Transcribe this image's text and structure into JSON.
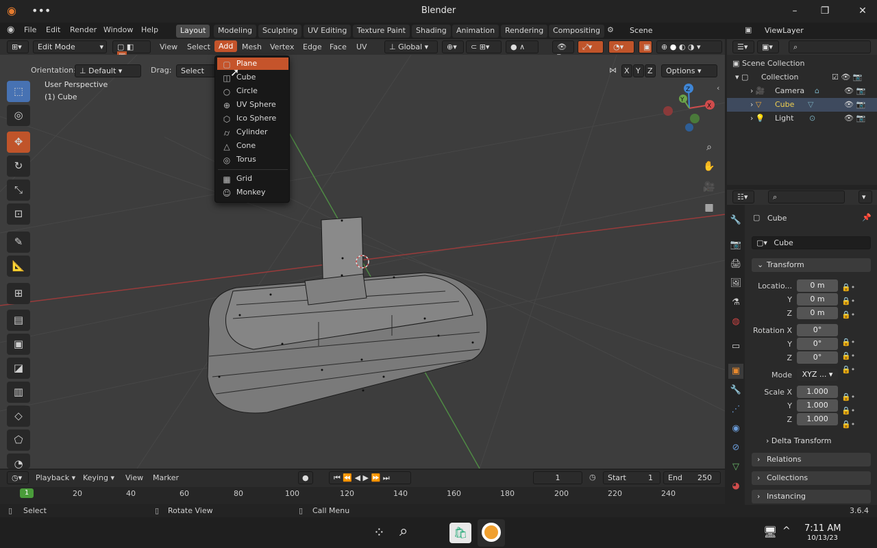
{
  "title_bar": {
    "title": "Blender",
    "min": "–",
    "max": "❐",
    "close": "✕"
  },
  "menus": [
    "File",
    "Edit",
    "Render",
    "Window",
    "Help"
  ],
  "workspaces": [
    "Layout",
    "Modeling",
    "Sculpting",
    "UV Editing",
    "Texture Paint",
    "Shading",
    "Animation",
    "Rendering",
    "Compositing"
  ],
  "scene": "Scene",
  "view_layer": "ViewLayer",
  "header": {
    "mode": "Edit Mode",
    "menus": [
      "View",
      "Select",
      "Add",
      "Mesh",
      "Vertex",
      "Edge",
      "Face",
      "UV"
    ],
    "transform_orientation": "Global",
    "orientation_label": "Orientation:",
    "orientation_value": "Default",
    "drag_label": "Drag:",
    "drag_value": "Select Bo",
    "axes": [
      "X",
      "Y",
      "Z"
    ],
    "options": "Options"
  },
  "viewport": {
    "line1": "User Perspective",
    "line2": "(1) Cube"
  },
  "add_menu": {
    "items": [
      {
        "label": "Plane",
        "icon": "plane-icon"
      },
      {
        "label": "Cube",
        "icon": "cube-icon"
      },
      {
        "label": "Circle",
        "icon": "circle-icon"
      },
      {
        "label": "UV Sphere",
        "icon": "uv-sphere-icon"
      },
      {
        "label": "Ico Sphere",
        "icon": "ico-sphere-icon"
      },
      {
        "label": "Cylinder",
        "icon": "cylinder-icon"
      },
      {
        "label": "Cone",
        "icon": "cone-icon"
      },
      {
        "label": "Torus",
        "icon": "torus-icon"
      },
      {
        "label": "Grid",
        "icon": "grid-icon"
      },
      {
        "label": "Monkey",
        "icon": "monkey-icon"
      }
    ]
  },
  "outliner": {
    "root": "Scene Collection",
    "collection": "Collection",
    "items": [
      "Camera",
      "Cube",
      "Light"
    ]
  },
  "properties": {
    "object_name": "Cube",
    "data_name": "Cube",
    "transform": "Transform",
    "location_label": "Locatio...",
    "location": [
      "0 m",
      "0 m",
      "0 m"
    ],
    "rotation_label": "Rotation X",
    "rotation": [
      "0°",
      "0°",
      "0°"
    ],
    "mode_label": "Mode",
    "mode_value": "XYZ ...",
    "scale_label": "Scale X",
    "scale": [
      "1.000",
      "1.000",
      "1.000"
    ],
    "y": "Y",
    "z": "Z",
    "delta": "Delta Transform",
    "panels": [
      "Relations",
      "Collections",
      "Instancing"
    ]
  },
  "timeline": {
    "playback": "Playback",
    "keying": "Keying",
    "view": "View",
    "marker": "Marker",
    "current_frame": "1",
    "start_label": "Start",
    "start": "1",
    "end_label": "End",
    "end": "250",
    "ticks": [
      "1",
      "20",
      "40",
      "60",
      "80",
      "100",
      "120",
      "140",
      "160",
      "180",
      "200",
      "220",
      "240"
    ]
  },
  "status": {
    "select": "Select",
    "rotate": "Rotate View",
    "call_menu": "Call Menu",
    "version": "3.6.4"
  },
  "taskbar": {
    "time": "7:11 AM",
    "date": "10/13/23"
  },
  "colors": {
    "accent": "#c5542b",
    "active_blue": "#4772b3",
    "x_axis": "#d04c4c",
    "y_axis": "#6ba44a",
    "z_axis": "#3f86d6"
  }
}
